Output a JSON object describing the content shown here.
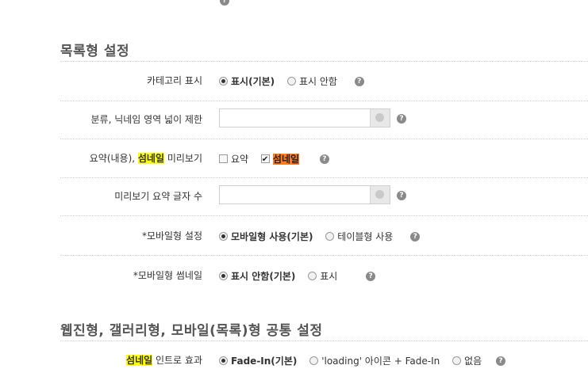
{
  "sections": {
    "list": {
      "title": "목록형 설정"
    },
    "common": {
      "title": "웹진형, 갤러리형, 모바일(목록)형 공통 설정"
    }
  },
  "rows": {
    "category": {
      "label": "카테고리 표시",
      "options": [
        "표시(기본)",
        "표시 안함"
      ],
      "selected": 0
    },
    "limit": {
      "label": "분류, 닉네임 영역 넓이 제한",
      "value": ""
    },
    "preview": {
      "label_pre": "요약(내용), ",
      "label_highlight": "섬네일",
      "label_post": " 미리보기",
      "opt_summary": "요약",
      "opt_thumb": "섬네일",
      "summary_checked": false,
      "thumb_checked": true
    },
    "preview_count": {
      "label": "미리보기 요약 글자 수",
      "value": ""
    },
    "mobile": {
      "label": "*모바일형 설정",
      "options": [
        "모바일형 사용(기본)",
        "테이블형 사용"
      ],
      "selected": 0
    },
    "mobile_thumb": {
      "label": "*모바일형 썸네일",
      "options": [
        "표시 안함(기본)",
        "표시"
      ],
      "selected": 0
    },
    "intro": {
      "label_highlight": "섬네일",
      "label_post": " 인트로 효과",
      "options": [
        "Fade-In(기본)",
        "'loading' 아이콘 + Fade-In",
        "없음"
      ],
      "selected": 0
    }
  },
  "help_glyph": "?",
  "colors": {
    "highlight_yellow": "#ffff00",
    "highlight_orange": "#ff7a1a"
  }
}
